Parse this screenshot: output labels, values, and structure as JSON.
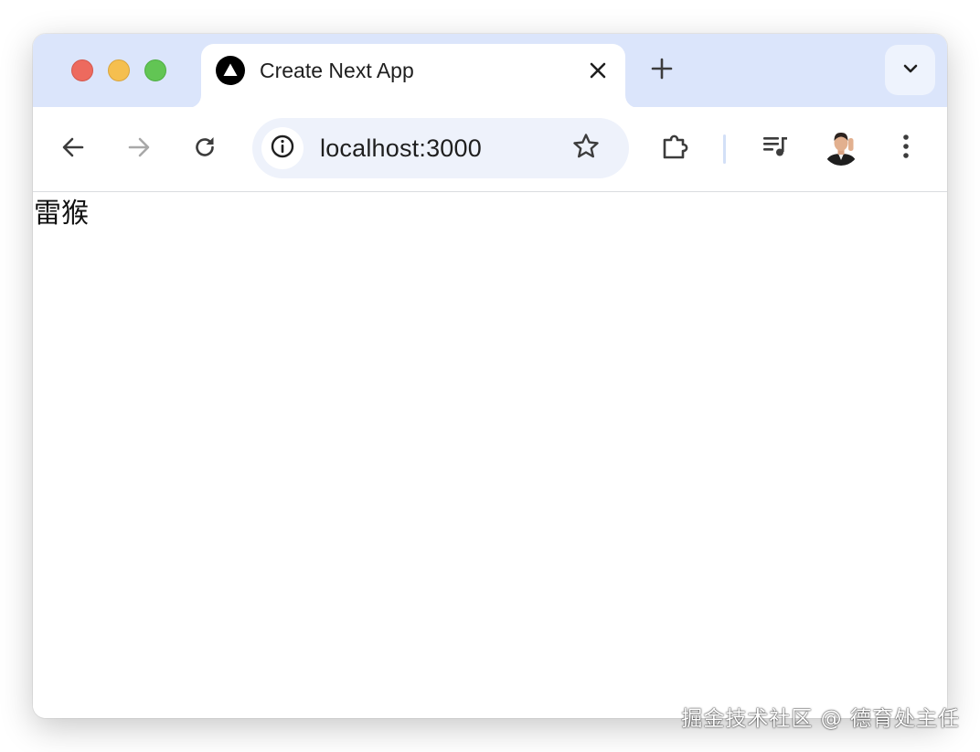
{
  "browser": {
    "tab": {
      "title": "Create Next App",
      "favicon": "nextjs-triangle-icon"
    },
    "omnibox": {
      "url": "localhost:3000"
    },
    "icons": {
      "back": "arrow-left-icon",
      "forward": "arrow-right-icon",
      "reload": "reload-icon",
      "info": "info-icon",
      "bookmark": "star-icon",
      "extensions": "puzzle-icon",
      "media": "queue-music-icon",
      "menu": "more-vert-icon",
      "new_tab": "plus-icon",
      "tab_search": "chevron-down-icon",
      "tab_close": "close-icon"
    },
    "colors": {
      "tabstrip": "#dbe5fb",
      "omnibox": "#eef2fb",
      "traffic_close": "#ed6a5e",
      "traffic_minimize": "#f5bf4f",
      "traffic_maximize": "#62c554"
    }
  },
  "page": {
    "text": "雷猴"
  },
  "watermark": {
    "text": "掘金技术社区 @ 德育处主任"
  }
}
